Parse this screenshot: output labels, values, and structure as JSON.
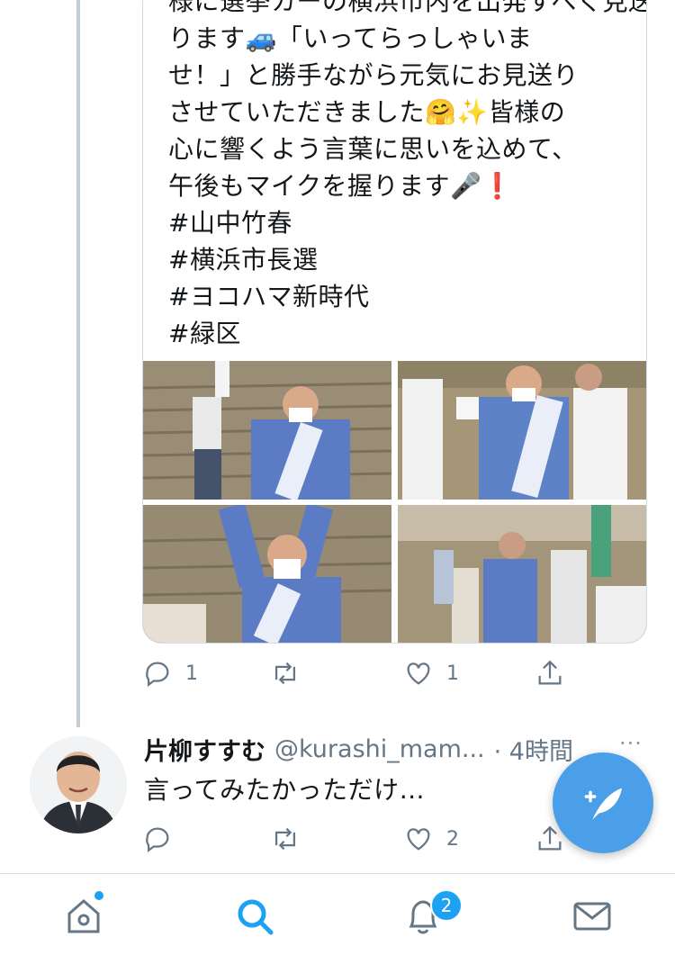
{
  "tweet1": {
    "text_lines": [
      "様に選挙カーの横浜市内を出発すべく見送",
      "ります🚙「いってらっしゃいま",
      "せ！」と勝手ながら元気にお見送り",
      "させていただきました🤗✨皆様の",
      "心に響くよう言葉に思いを込めて、",
      "午後もマイクを握ります🎤❗",
      "#山中竹春",
      "#横浜市長選",
      "#ヨコハマ新時代",
      "#緑区"
    ],
    "replies": "1",
    "retweets": "",
    "likes": "1"
  },
  "tweet2": {
    "name": "片柳すすむ",
    "handle": "@kurashi_mam...",
    "time": "· 4時間",
    "more": "···",
    "text": "言ってみたかっただけ…",
    "replies": "",
    "retweets": "",
    "likes": "2"
  },
  "nav": {
    "notifications_badge": "2"
  },
  "colors": {
    "accent": "#1da1f2",
    "fab": "#4a9fe8",
    "muted": "#657786"
  }
}
